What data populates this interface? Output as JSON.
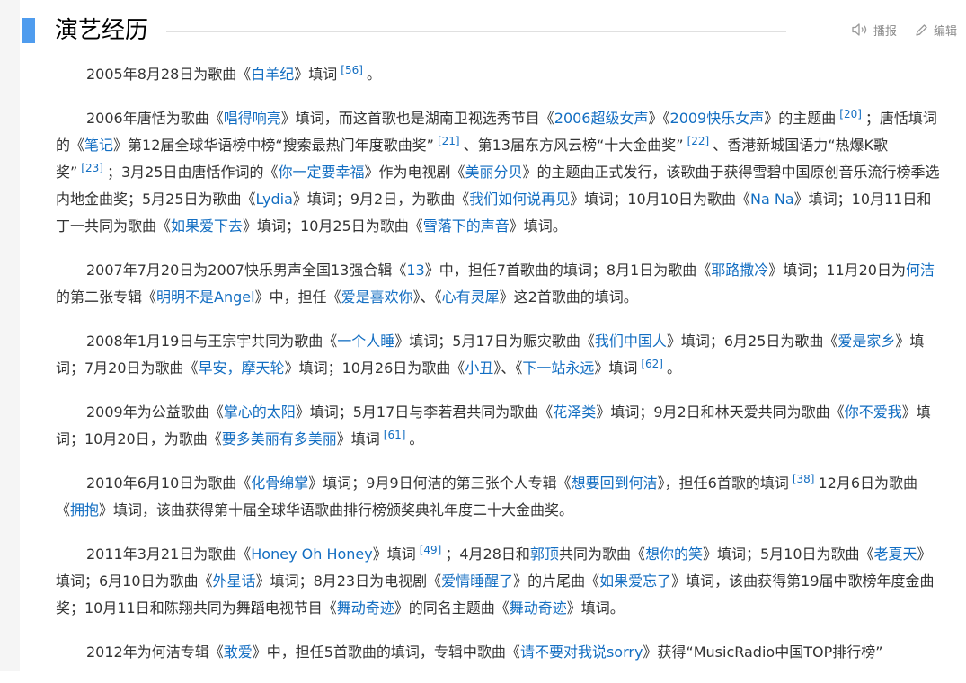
{
  "section": {
    "title": "演艺经历"
  },
  "toolbar": {
    "broadcast": "播报",
    "edit": "编辑"
  },
  "paragraphs": [
    [
      {
        "t": "2005年8月28日为歌曲《"
      },
      {
        "l": "白羊纪"
      },
      {
        "t": "》填词"
      },
      {
        "r": "[56]"
      },
      {
        "t": "。"
      }
    ],
    [
      {
        "t": "2006年唐恬为歌曲《"
      },
      {
        "l": "唱得响亮"
      },
      {
        "t": "》填词，而这首歌也是湖南卫视选秀节目《"
      },
      {
        "l": "2006超级女声"
      },
      {
        "t": "》《"
      },
      {
        "l": "2009快乐女声"
      },
      {
        "t": "》的主题曲"
      },
      {
        "r": "[20]"
      },
      {
        "t": "；唐恬填词的《"
      },
      {
        "l": "笔记"
      },
      {
        "t": "》第12届全球华语榜中榜“搜索最热门年度歌曲奖”"
      },
      {
        "r": "[21]"
      },
      {
        "t": "、第13届东方风云榜“十大金曲奖”"
      },
      {
        "r": "[22]"
      },
      {
        "t": "、香港新城国语力“热爆K歌奖”"
      },
      {
        "r": "[23]"
      },
      {
        "t": "；3月25日由唐恬作词的《"
      },
      {
        "l": "你一定要幸福"
      },
      {
        "t": "》作为电视剧《"
      },
      {
        "l": "美丽分贝"
      },
      {
        "t": "》的主题曲正式发行，该歌曲于获得雪碧中国原创音乐流行榜季选内地金曲奖；5月25日为歌曲《"
      },
      {
        "l": "Lydia"
      },
      {
        "t": "》填词；9月2日，为歌曲《"
      },
      {
        "l": "我们如何说再见"
      },
      {
        "t": "》填词；10月10日为歌曲《"
      },
      {
        "l": "Na Na"
      },
      {
        "t": "》填词；10月11日和丁一共同为歌曲《"
      },
      {
        "l": "如果爱下去"
      },
      {
        "t": "》填词；10月25日为歌曲《"
      },
      {
        "l": "雪落下的声音"
      },
      {
        "t": "》填词。"
      }
    ],
    [
      {
        "t": "2007年7月20日为2007快乐男声全国13强合辑《"
      },
      {
        "l": "13"
      },
      {
        "t": "》中，担任7首歌曲的填词；8月1日为歌曲《"
      },
      {
        "l": "耶路撒冷"
      },
      {
        "t": "》填词；11月20日为"
      },
      {
        "l": "何洁"
      },
      {
        "t": "的第二张专辑《"
      },
      {
        "l": "明明不是Angel"
      },
      {
        "t": "》中，担任《"
      },
      {
        "l": "爱是喜欢你"
      },
      {
        "t": "》、《"
      },
      {
        "l": "心有灵犀"
      },
      {
        "t": "》这2首歌曲的填词。"
      }
    ],
    [
      {
        "t": "2008年1月19日与王宗宇共同为歌曲《"
      },
      {
        "l": "一个人睡"
      },
      {
        "t": "》填词；5月17日为赈灾歌曲《"
      },
      {
        "l": "我们中国人"
      },
      {
        "t": "》填词；6月25日为歌曲《"
      },
      {
        "l": "爱是家乡"
      },
      {
        "t": "》填词；7月20日为歌曲《"
      },
      {
        "l": "早安，摩天轮"
      },
      {
        "t": "》填词；10月26日为歌曲《"
      },
      {
        "l": "小丑"
      },
      {
        "t": "》、《"
      },
      {
        "l": "下一站永远"
      },
      {
        "t": "》填词"
      },
      {
        "r": "[62]"
      },
      {
        "t": "。"
      }
    ],
    [
      {
        "t": "2009年为公益歌曲《"
      },
      {
        "l": "掌心的太阳"
      },
      {
        "t": "》填词；5月17日与李若君共同为歌曲《"
      },
      {
        "l": "花泽类"
      },
      {
        "t": "》填词；9月2日和林天爱共同为歌曲《"
      },
      {
        "l": "你不爱我"
      },
      {
        "t": "》填词；10月20日，为歌曲《"
      },
      {
        "l": "要多美丽有多美丽"
      },
      {
        "t": "》填词"
      },
      {
        "r": "[61]"
      },
      {
        "t": "。"
      }
    ],
    [
      {
        "t": "2010年6月10日为歌曲《"
      },
      {
        "l": "化骨绵掌"
      },
      {
        "t": "》填词；9月9日何洁的第三张个人专辑《"
      },
      {
        "l": "想要回到何洁"
      },
      {
        "t": "》，担任6首歌的填词"
      },
      {
        "r": "[38]"
      },
      {
        "t": "12月6日为歌曲《"
      },
      {
        "l": "拥抱"
      },
      {
        "t": "》填词，该曲获得第十届全球华语歌曲排行榜颁奖典礼年度二十大金曲奖。"
      }
    ],
    [
      {
        "t": "2011年3月21日为歌曲《"
      },
      {
        "l": "Honey Oh Honey"
      },
      {
        "t": "》填词"
      },
      {
        "r": "[49]"
      },
      {
        "t": "；4月28日和"
      },
      {
        "l": "郭顶"
      },
      {
        "t": "共同为歌曲《"
      },
      {
        "l": "想你的笑"
      },
      {
        "t": "》填词；5月10日为歌曲《"
      },
      {
        "l": "老夏天"
      },
      {
        "t": "》填词；6月10日为歌曲《"
      },
      {
        "l": "外星话"
      },
      {
        "t": "》填词；8月23日为电视剧《"
      },
      {
        "l": "爱情睡醒了"
      },
      {
        "t": "》的片尾曲《"
      },
      {
        "l": "如果爱忘了"
      },
      {
        "t": "》填词，该曲获得第19届中歌榜年度金曲奖；10月11日和陈翔共同为舞蹈电视节目《"
      },
      {
        "l": "舞动奇迹"
      },
      {
        "t": "》的同名主题曲《"
      },
      {
        "l": "舞动奇迹"
      },
      {
        "t": "》填词。"
      }
    ],
    [
      {
        "t": "2012年为何洁专辑《"
      },
      {
        "l": "敢爱"
      },
      {
        "t": "》中，担任5首歌曲的填词，专辑中歌曲《"
      },
      {
        "l": "请不要对我说sorry"
      },
      {
        "t": "》获得“MusicRadio中国TOP排行榜”"
      }
    ]
  ]
}
